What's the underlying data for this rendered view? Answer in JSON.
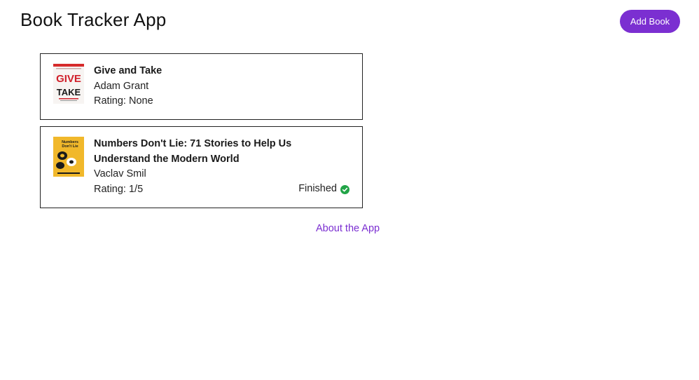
{
  "app": {
    "title": "Book Tracker App",
    "add_button_label": "Add Book"
  },
  "books": [
    {
      "title": "Give and Take",
      "author": "Adam Grant",
      "rating": "Rating: None",
      "cover_icon": "book-cover-give-and-take",
      "cover_text_top": "GIVE",
      "cover_text_bottom": "TAKE"
    },
    {
      "title": "Numbers Don't Lie: 71 Stories to Help Us Understand the Modern World",
      "author": "Vaclav Smil",
      "rating": "Rating: 1/5",
      "status": "Finished",
      "status_icon": "check-circle-icon",
      "status_color": "#22a447",
      "cover_icon": "book-cover-numbers-dont-lie",
      "cover_text": "Numbers Don't Lie"
    }
  ],
  "footer": {
    "about_link": "About the App"
  },
  "colors": {
    "accent": "#7b2fd1",
    "success": "#22a447"
  }
}
